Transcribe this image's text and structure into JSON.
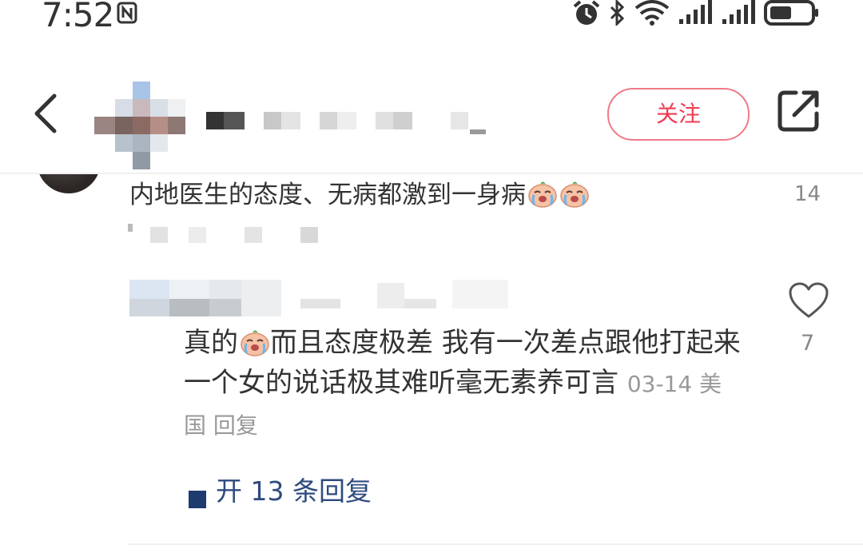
{
  "status_bar": {
    "time": "7:52",
    "icons": [
      "nfc-icon",
      "alarm-icon",
      "bluetooth-icon",
      "wifi-icon",
      "signal-icon",
      "signal-icon",
      "battery-icon"
    ]
  },
  "header": {
    "back_icon": "chevron-left-icon",
    "follow_label": "关注",
    "share_icon": "share-icon"
  },
  "comment": {
    "text": "内地医生的态度、无病都激到一身病",
    "emoji": "crying-face-emoji",
    "like_count": "14"
  },
  "reply": {
    "text": "真的",
    "text_after_emoji": "而且态度极差 我有一次差点跟他打起来 一个女的说话极其难听毫无素养可言",
    "date": "03-14",
    "location": "美国",
    "reply_label": "回复",
    "like_count": "7"
  },
  "expand": {
    "label": "开 13 条回复"
  },
  "colors": {
    "accent_red": "#ee3d53",
    "link_blue": "#2e4a7e",
    "meta_gray": "#999999"
  }
}
